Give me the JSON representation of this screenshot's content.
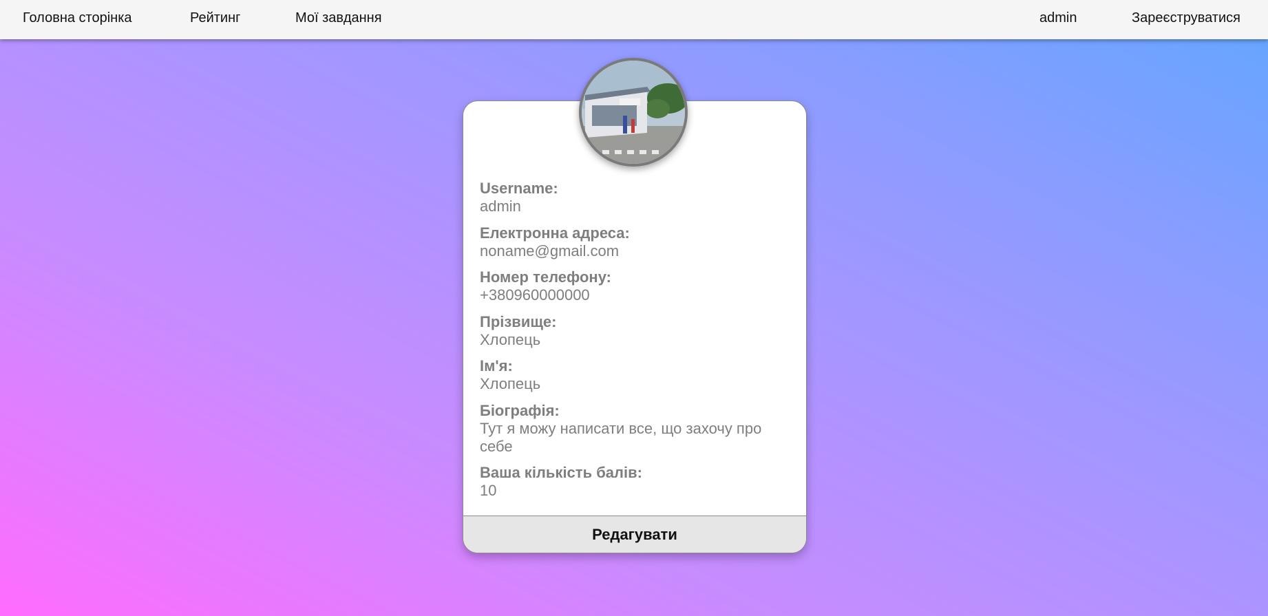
{
  "nav": {
    "home": "Головна сторінка",
    "rating": "Рейтинг",
    "my_tasks": "Мої завдання",
    "user": "admin",
    "register": "Зареєструватися"
  },
  "profile": {
    "avatar_icon": "profile-photo",
    "fields": [
      {
        "label": "Username:",
        "value": "admin"
      },
      {
        "label": "Електронна адреса:",
        "value": "noname@gmail.com"
      },
      {
        "label": "Номер телефону:",
        "value": "+380960000000"
      },
      {
        "label": "Прізвище:",
        "value": "Хлопець"
      },
      {
        "label": "Ім'я:",
        "value": "Хлопець"
      },
      {
        "label": "Біографія:",
        "value": "Тут я можу написати все, що захочу про себе"
      },
      {
        "label": "Ваша кількість балів:",
        "value": "10"
      }
    ],
    "edit_label": "Редагувати"
  },
  "colors": {
    "gradient_start": "#ff6cff",
    "gradient_end": "#62a6ff",
    "navbar_bg": "#f5f5f5",
    "field_text": "#7e7e7e"
  }
}
